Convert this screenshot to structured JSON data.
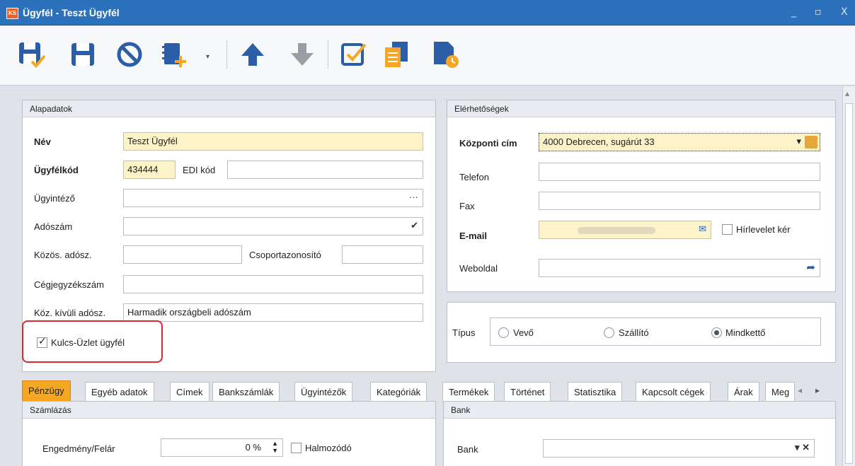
{
  "window": {
    "app_icon": "KS",
    "title": "Ügyfél - Teszt Ügyfél",
    "controls": [
      "_",
      "▫",
      "X"
    ]
  },
  "toolbar": {
    "items": [
      "save-and-close-icon",
      "save-icon",
      "cancel-icon",
      "new-document-icon",
      "dropdown-arrow-icon",
      "move-up-icon",
      "move-down-icon",
      "checklist-icon",
      "copy-document-icon",
      "scheduled-document-icon"
    ]
  },
  "alapadatok": {
    "title": "Alapadatok",
    "nev_label": "Név",
    "nev_value": "Teszt Ügyfél",
    "ugyfelkod_label": "Ügyfélkód",
    "ugyfelkod_value": "434444",
    "edi_label": "EDI kód",
    "edi_value": "",
    "ugyintezo_label": "Ügyintéző",
    "ugyintezo_value": "",
    "ugyintezo_button": "···",
    "adoszam_label": "Adószám",
    "adoszam_value": "",
    "adoszam_button": "✔",
    "kozos_label": "Közös. adósz.",
    "kozos_value": "",
    "csoport_label": "Csoportazonosító",
    "csoport_value": "",
    "cegjegyzek_label": "Cégjegyzékszám",
    "cegjegyzek_value": "",
    "kozkivuli_label": "Köz. kívüli adósz.",
    "kozkivuli_value": "Harmadik országbeli adószám",
    "kulcs_label": "Kulcs-Üzlet ügyfél",
    "kulcs_checked": true
  },
  "elerhetosegek": {
    "title": "Elérhetőségek",
    "kozponti_label": "Központi cím",
    "kozponti_value": "4000 Debrecen, sugárút 33",
    "kozponti_dropdown": "▾",
    "telefon_label": "Telefon",
    "telefon_value": "",
    "fax_label": "Fax",
    "fax_value": "",
    "email_label": "E-mail",
    "email_button": "✉",
    "hirlevel_label": "Hírlevelet kér",
    "hirlevel_checked": false,
    "weboldal_label": "Weboldal",
    "weboldal_value": "",
    "weboldal_button": "➦"
  },
  "tipus": {
    "label": "Típus",
    "options": [
      {
        "label": "Vevő",
        "selected": false
      },
      {
        "label": "Szállító",
        "selected": false
      },
      {
        "label": "Mindkettő",
        "selected": true
      }
    ]
  },
  "tabs": [
    "Pénzügy",
    "Egyéb adatok",
    "Címek",
    "Bankszámlák",
    "Ügyintézők",
    "Kategóriák",
    "Termékek",
    "Történet",
    "Statisztika",
    "Kapcsolt cégek",
    "Árak",
    "Meg"
  ],
  "tab_scroll": {
    "left": "◂",
    "right": "▸"
  },
  "szamlazas": {
    "title": "Számlázás",
    "engedmeny_label": "Engedmény/Felár",
    "engedmeny_value": "0 %",
    "halmozodo_label": "Halmozódó",
    "halmozodo_checked": false
  },
  "bank": {
    "title": "Bank",
    "bank_label": "Bank",
    "bank_value": "",
    "bank_buttons": "▾ ✕"
  },
  "colors": {
    "titlebar": "#2b71bc",
    "required_field": "#fdf3c8",
    "active_tab": "#f5a623",
    "highlight": "#e0282f",
    "toolbar_icon": "#2c5ea8"
  }
}
